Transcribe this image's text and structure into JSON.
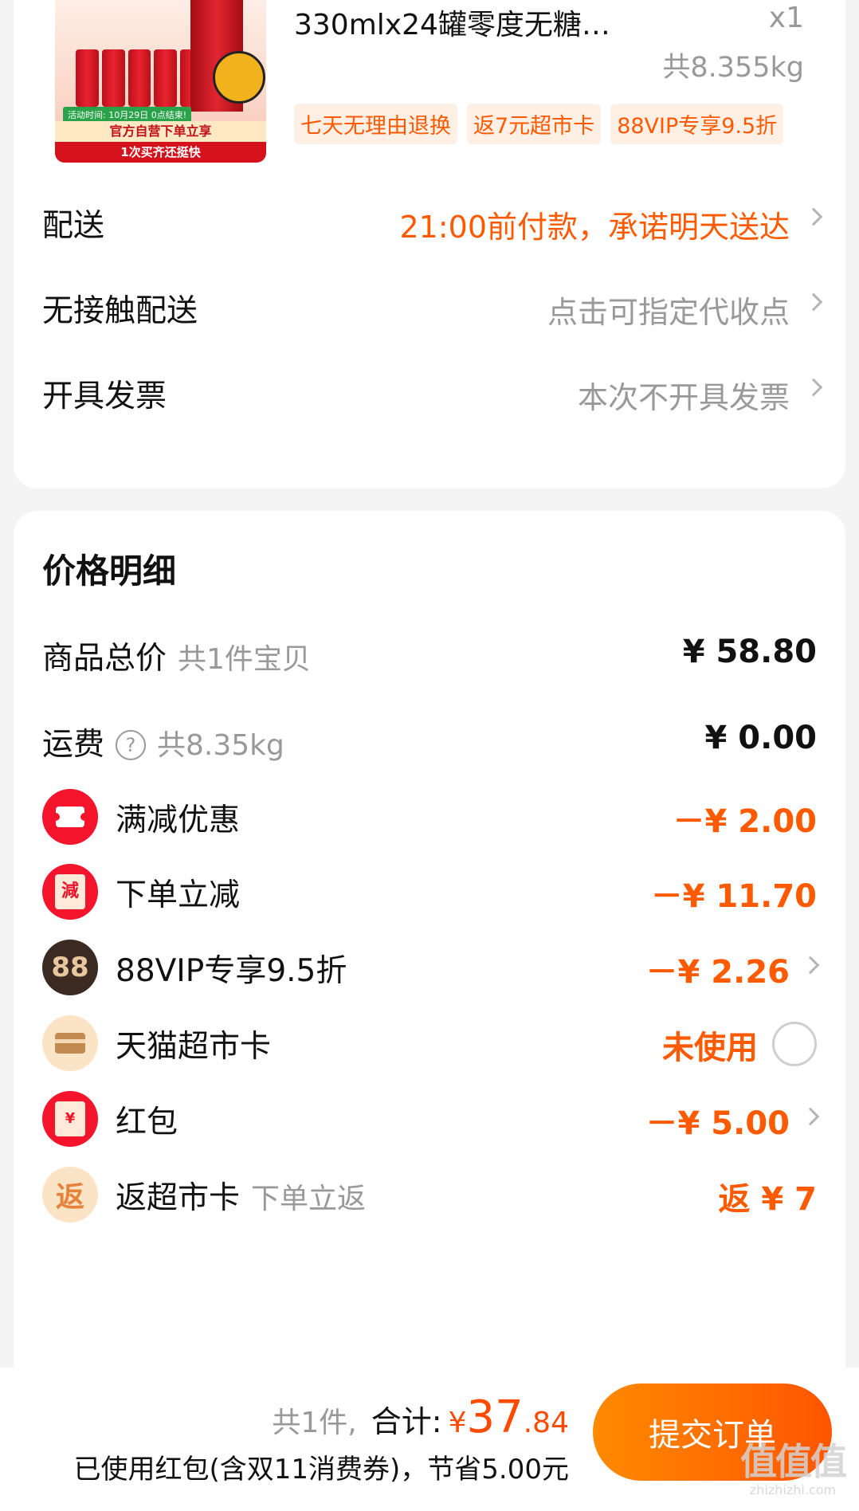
{
  "product": {
    "title": "330mlx24罐零度无糖…",
    "quantity": "x1",
    "weight": "共8.355kg",
    "image_promo": {
      "date": "活动时间: 10月29日 0点结束!",
      "main": "官方自营下单立享",
      "sub": "1次买齐还挺快"
    },
    "tags": [
      "七天无理由退换",
      "返7元超市卡",
      "88VIP专享9.5折"
    ]
  },
  "options": [
    {
      "label": "配送",
      "value": "21:00前付款，承诺明天送达",
      "tone": "orange"
    },
    {
      "label": "无接触配送",
      "value": "点击可指定代收点",
      "tone": "gray"
    },
    {
      "label": "开具发票",
      "value": "本次不开具发票",
      "tone": "gray"
    }
  ],
  "price_detail": {
    "title": "价格明细",
    "goods_total": {
      "label": "商品总价",
      "sub": "共1件宝贝",
      "amount": "¥ 58.80"
    },
    "shipping": {
      "label": "运费",
      "sub": "共8.35kg",
      "help_glyph": "?",
      "amount": "¥ 0.00"
    },
    "discounts": [
      {
        "label": "满减优惠",
        "amount": "－¥ 2.00",
        "icon": "ticket-icon"
      },
      {
        "label": "下单立减",
        "amount": "－¥ 11.70",
        "icon": "jian-icon",
        "icon_text": "減"
      },
      {
        "label": "88VIP专享9.5折",
        "amount": "－¥ 2.26",
        "icon": "vip88-icon",
        "icon_text": "88"
      },
      {
        "label": "天猫超市卡",
        "amount": "未使用",
        "icon": "card-icon"
      },
      {
        "label": "红包",
        "amount": "－¥ 5.00",
        "icon": "red-packet-icon",
        "icon_text": "¥"
      },
      {
        "label": "返超市卡",
        "sub": "下单立返",
        "amount": "返 ¥ 7",
        "icon": "fan-icon",
        "icon_text": "返"
      }
    ]
  },
  "bottom_bar": {
    "count": "共1件,",
    "total_label": "合计:",
    "currency": "¥",
    "total_int": "37",
    "total_dec": ".84",
    "savings": "已使用红包(含双11消费券)，节省5.00元",
    "submit_label": "提交订单"
  },
  "watermark": {
    "big": "值值值",
    "small": "zhizhizhi.com"
  },
  "colors": {
    "accent": "#ff5a00",
    "submit_gradient_start": "#ff8a00",
    "submit_gradient_end": "#ff5500"
  }
}
